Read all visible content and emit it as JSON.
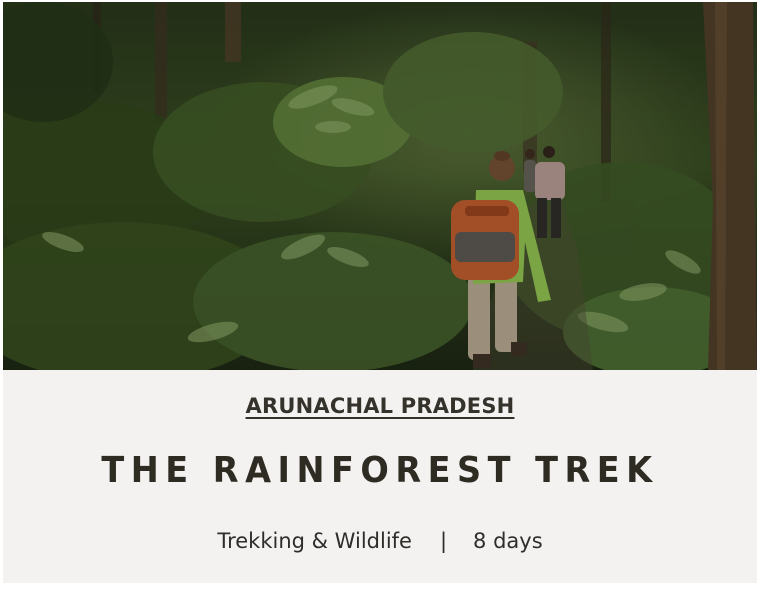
{
  "card": {
    "image": {
      "alt": "Trekkers walking through dense green rainforest",
      "icon": "rainforest-photo"
    },
    "region": "ARUNACHAL PRADESH",
    "title": "THE RAINFOREST TREK",
    "category": "Trekking & Wildlife",
    "separator": "|",
    "duration": "8 days",
    "colors": {
      "panel": "#f4f2f1",
      "text": "#2e2b22",
      "forest_dark": "#1f2a16",
      "forest_mid": "#3b5326",
      "jacket": "#86b24a",
      "backpack": "#b0552a"
    }
  }
}
